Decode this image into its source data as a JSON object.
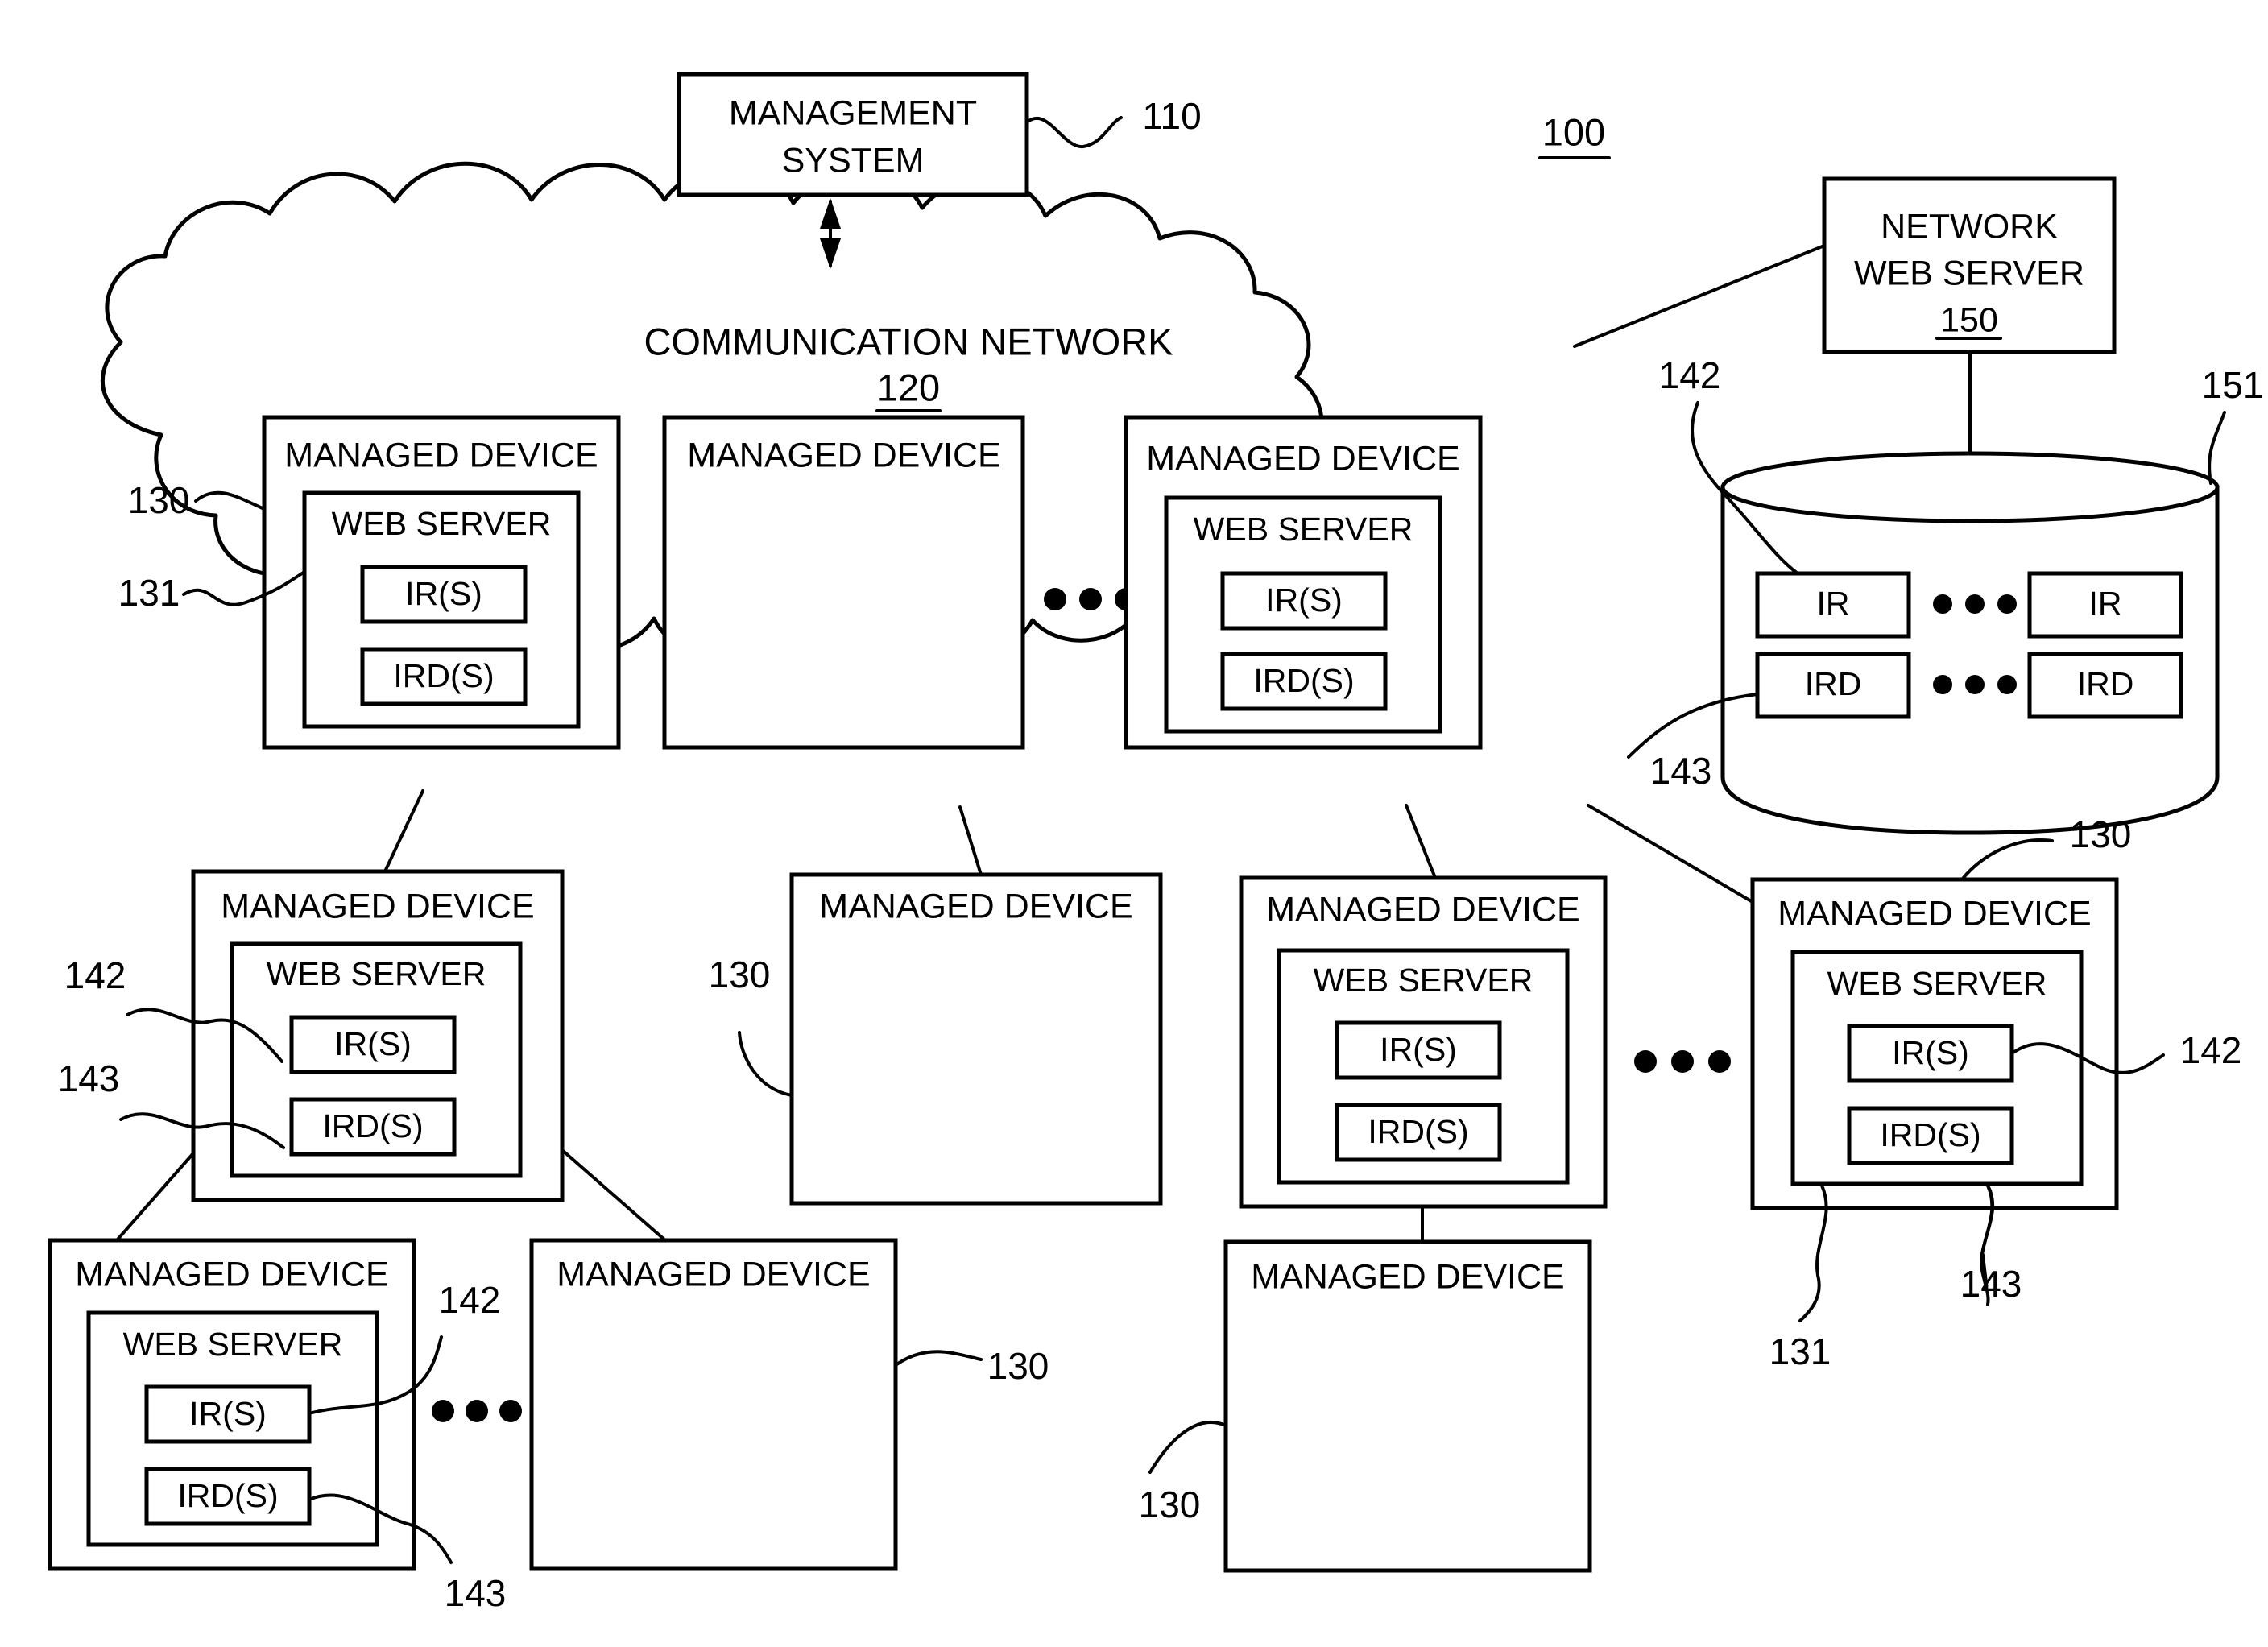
{
  "figure": {
    "number": "100",
    "cloud_label": "COMMUNICATION NETWORK",
    "cloud_ref": "120"
  },
  "management_system": {
    "label_line1": "MANAGEMENT",
    "label_line2": "SYSTEM",
    "ref": "110"
  },
  "network_web_server": {
    "label_line1": "NETWORK",
    "label_line2": "WEB SERVER",
    "ref": "150"
  },
  "database": {
    "ref": "151",
    "ir_label": "IR",
    "ird_label": "IRD",
    "ir_ref": "142",
    "ird_ref": "143",
    "ellipsis": "•••"
  },
  "labels": {
    "managed_device": "MANAGED DEVICE",
    "web_server": "WEB SERVER",
    "ir_s": "IR(S)",
    "ird_s": "IRD(S)",
    "ref_device": "130",
    "ref_web_server": "131",
    "ref_ir": "142",
    "ref_ird": "143",
    "ellipsis": "•••"
  },
  "devices": [
    {
      "id": "cloud-device-1",
      "name": "MANAGED DEVICE",
      "has_web_server": true,
      "refs": [
        "130",
        "131"
      ]
    },
    {
      "id": "cloud-device-2",
      "name": "MANAGED DEVICE",
      "has_web_server": false,
      "refs": []
    },
    {
      "id": "cloud-device-3",
      "name": "MANAGED DEVICE",
      "has_web_server": true,
      "refs": []
    },
    {
      "id": "row2-device-1",
      "name": "MANAGED DEVICE",
      "has_web_server": true,
      "refs": [
        "142",
        "143"
      ]
    },
    {
      "id": "row2-device-2",
      "name": "MANAGED DEVICE",
      "has_web_server": false,
      "refs": [
        "130"
      ]
    },
    {
      "id": "row2-device-3",
      "name": "MANAGED DEVICE",
      "has_web_server": true,
      "refs": []
    },
    {
      "id": "row2-device-4",
      "name": "MANAGED DEVICE",
      "has_web_server": true,
      "refs": [
        "130",
        "142",
        "131",
        "143"
      ]
    },
    {
      "id": "row3-device-1",
      "name": "MANAGED DEVICE",
      "has_web_server": true,
      "refs": [
        "142",
        "143"
      ]
    },
    {
      "id": "row3-device-2",
      "name": "MANAGED DEVICE",
      "has_web_server": false,
      "refs": [
        "130"
      ]
    },
    {
      "id": "row3-device-3",
      "name": "MANAGED DEVICE",
      "has_web_server": false,
      "refs": [
        "130"
      ]
    }
  ]
}
